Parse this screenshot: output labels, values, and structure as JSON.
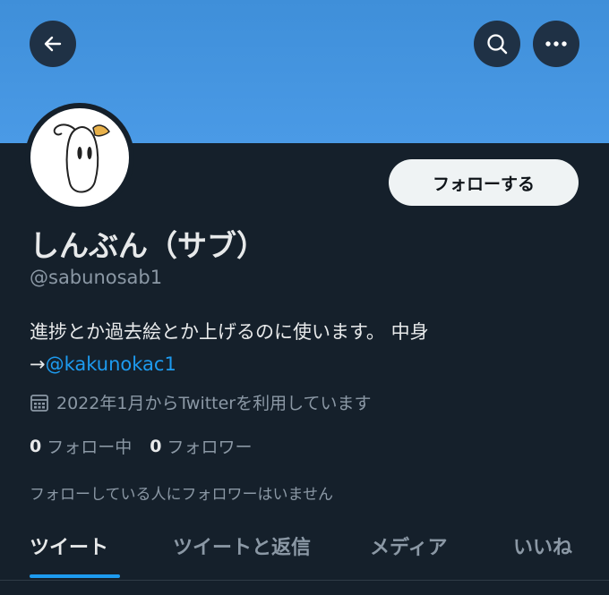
{
  "header": {
    "back_icon": "arrow-left-icon",
    "search_icon": "search-icon",
    "more_icon": "more-horizontal-icon",
    "banner_color": "#4a9ae6"
  },
  "profile": {
    "display_name": "しんぶん（サブ）",
    "handle": "@sabunosab1",
    "bio_text": "進捗とか過去絵とか上げるのに使います。 中身",
    "bio_arrow": "→",
    "bio_link": "@kakunokac1",
    "joined": "2022年1月からTwitterを利用しています",
    "following_count": "0",
    "following_label": "フォロー中",
    "followers_count": "0",
    "followers_label": "フォロワー",
    "no_followers_note": "フォローしている人にフォロワーはいません"
  },
  "actions": {
    "follow_label": "フォローする"
  },
  "tabs": [
    {
      "label": "ツイート",
      "active": true
    },
    {
      "label": "ツイートと返信",
      "active": false
    },
    {
      "label": "メディア",
      "active": false
    },
    {
      "label": "いいね",
      "active": false
    }
  ],
  "colors": {
    "background": "#15202b",
    "accent": "#1d9bf0",
    "muted_text": "#8b98a5"
  }
}
